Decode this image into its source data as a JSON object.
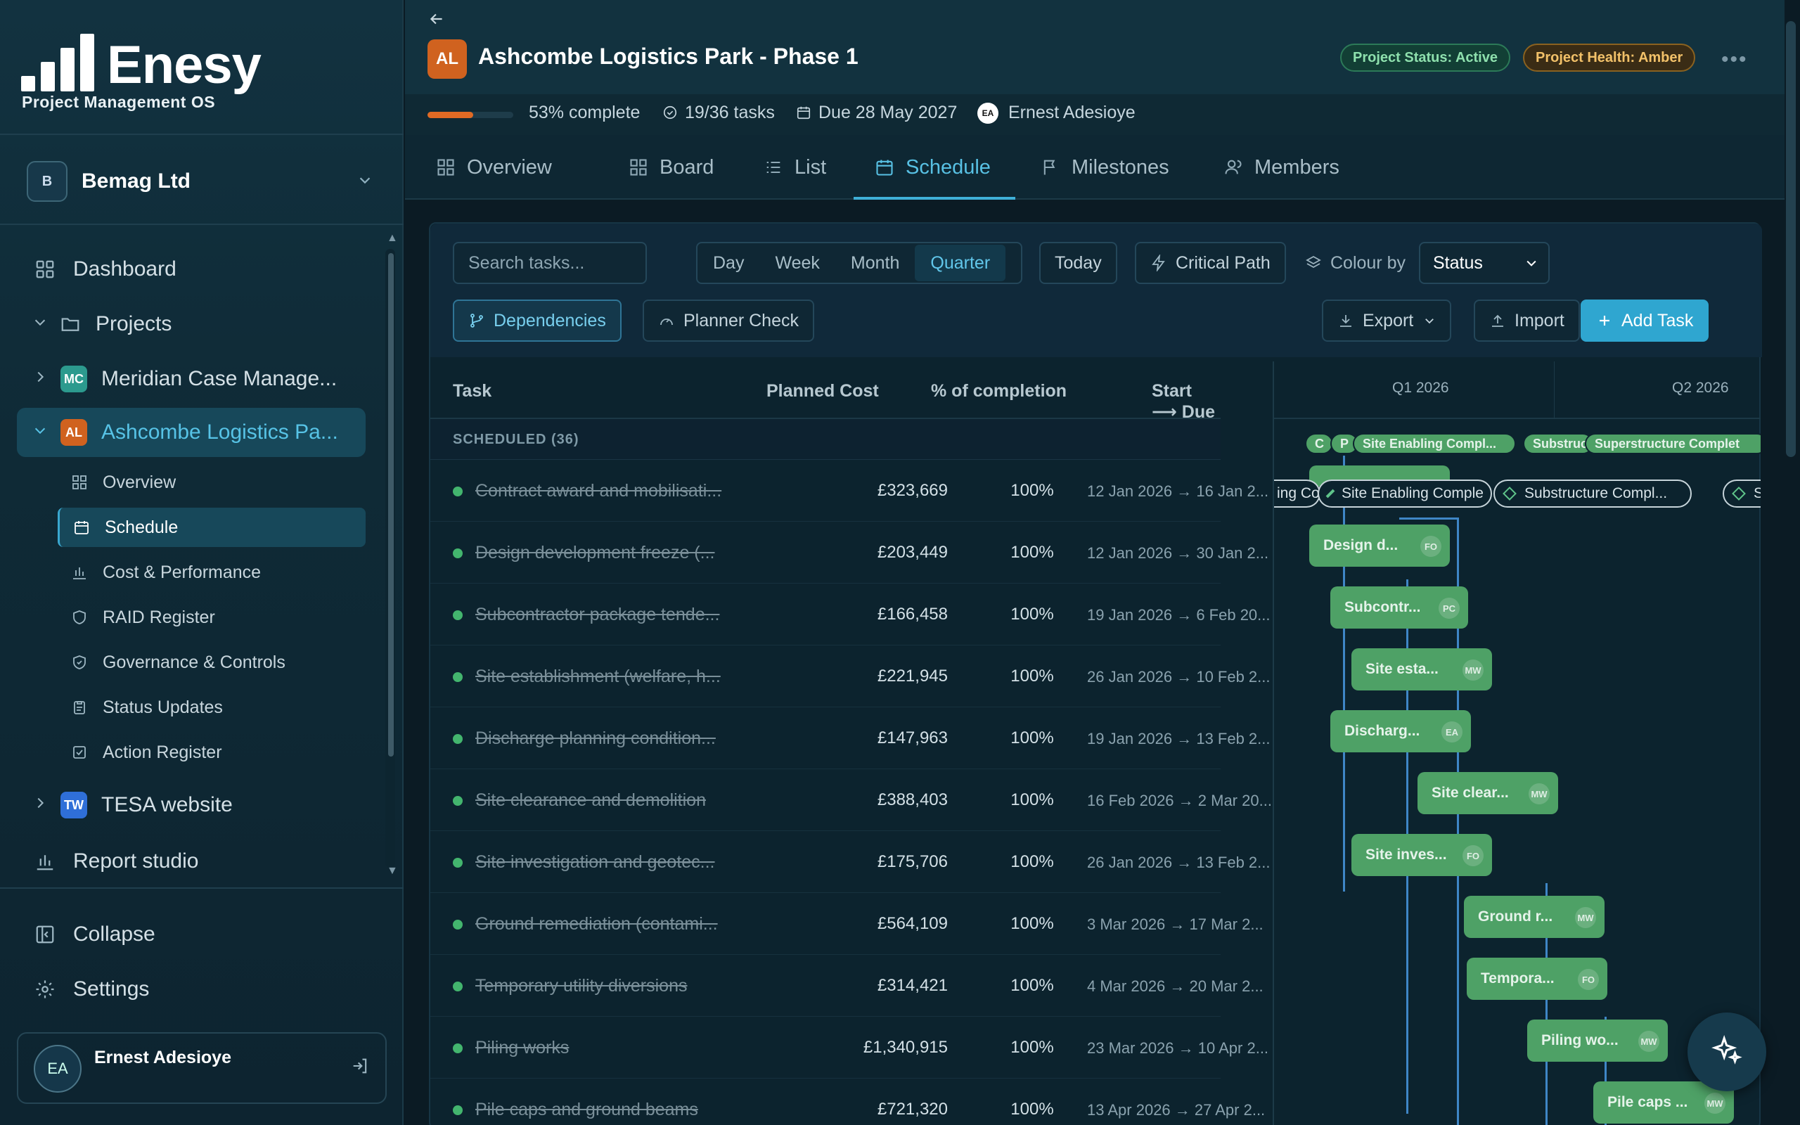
{
  "brand": {
    "name": "Enesy",
    "tagline": "Project Management OS"
  },
  "org": {
    "initial": "B",
    "name": "Bemag Ltd"
  },
  "nav": {
    "dashboard": "Dashboard",
    "projects": "Projects",
    "projects_list": [
      {
        "badge": "MC",
        "label": "Meridian Case Manage...",
        "color": "#2c9a8e"
      },
      {
        "badge": "AL",
        "label": "Ashcombe Logistics Pa...",
        "color": "#d0621f"
      },
      {
        "badge": "TW",
        "label": "TESA website",
        "color": "#2f6fd8"
      }
    ],
    "sub_items": [
      "Overview",
      "Schedule",
      "Cost & Performance",
      "RAID Register",
      "Governance & Controls",
      "Status Updates",
      "Action Register"
    ],
    "report_studio": "Report studio",
    "collapse": "Collapse",
    "settings": "Settings"
  },
  "user": {
    "initials": "EA",
    "name": "Ernest Adesioye"
  },
  "project": {
    "initials": "AL",
    "title": "Ashcombe Logistics Park - Phase 1",
    "status": "Project Status: Active",
    "health": "Project Health: Amber",
    "progress": 53,
    "progress_text": "53% complete",
    "tasks": "19/36 tasks",
    "due": "Due 28 May 2027",
    "owner_initials": "EA",
    "owner": "Ernest Adesioye"
  },
  "tabs": [
    "Overview",
    "Board",
    "List",
    "Schedule",
    "Milestones",
    "Members"
  ],
  "toolbar": {
    "search_placeholder": "Search tasks...",
    "scale": [
      "Day",
      "Week",
      "Month",
      "Quarter"
    ],
    "today": "Today",
    "critical_path": "Critical Path",
    "colour_by": "Colour by",
    "colour_value": "Status",
    "dependencies": "Dependencies",
    "planner_check": "Planner Check",
    "export": "Export",
    "import": "Import",
    "add_task": "Add Task"
  },
  "table": {
    "headers": {
      "task": "Task",
      "cost": "Planned Cost",
      "pct": "% of completion",
      "dates": "Start ⟶ Due"
    },
    "group": "SCHEDULED (36)",
    "rows": [
      {
        "name": "Contract award and mobilisati...",
        "cost": "£323,669",
        "pct": "100%",
        "dates": "12 Jan 2026 → 16 Jan 2..."
      },
      {
        "name": "Design development freeze (...",
        "cost": "£203,449",
        "pct": "100%",
        "dates": "12 Jan 2026 → 30 Jan 2..."
      },
      {
        "name": "Subcontractor package tende...",
        "cost": "£166,458",
        "pct": "100%",
        "dates": "19 Jan 2026 → 6 Feb 20..."
      },
      {
        "name": "Site establishment (welfare, h...",
        "cost": "£221,945",
        "pct": "100%",
        "dates": "26 Jan 2026 → 10 Feb 2..."
      },
      {
        "name": "Discharge planning condition...",
        "cost": "£147,963",
        "pct": "100%",
        "dates": "19 Jan 2026 → 13 Feb 2..."
      },
      {
        "name": "Site clearance and demolition",
        "cost": "£388,403",
        "pct": "100%",
        "dates": "16 Feb 2026 → 2 Mar 20..."
      },
      {
        "name": "Site investigation and geotec...",
        "cost": "£175,706",
        "pct": "100%",
        "dates": "26 Jan 2026 → 13 Feb 2..."
      },
      {
        "name": "Ground remediation (contami...",
        "cost": "£564,109",
        "pct": "100%",
        "dates": "3 Mar 2026 → 17 Mar 2..."
      },
      {
        "name": "Temporary utility diversions",
        "cost": "£314,421",
        "pct": "100%",
        "dates": "4 Mar 2026 → 20 Mar 2..."
      },
      {
        "name": "Piling works",
        "cost": "£1,340,915",
        "pct": "100%",
        "dates": "23 Mar 2026 → 10 Apr 2..."
      },
      {
        "name": "Pile caps and ground beams",
        "cost": "£721,320",
        "pct": "100%",
        "dates": "13 Apr 2026 → 27 Apr 2..."
      }
    ]
  },
  "gantt": {
    "quarters": [
      "Q1 2026",
      "Q2 2026"
    ],
    "summary_pills": [
      "C",
      "P",
      "Site Enabling Compl...",
      "Substruc",
      "Superstructure Complet"
    ],
    "milestones": [
      "ing Co",
      "Site Enabling Comple",
      "Substructure Compl...",
      "S"
    ],
    "bars": [
      {
        "label": "",
        "ini": ""
      },
      {
        "label": "Design d...",
        "ini": "FO"
      },
      {
        "label": "Subcontr...",
        "ini": "PC"
      },
      {
        "label": "Site esta...",
        "ini": "MW"
      },
      {
        "label": "Discharg...",
        "ini": "EA"
      },
      {
        "label": "Site clear...",
        "ini": "MW"
      },
      {
        "label": "Site inves...",
        "ini": "FO"
      },
      {
        "label": "Ground r...",
        "ini": "MW"
      },
      {
        "label": "Tempora...",
        "ini": "FO"
      },
      {
        "label": "Piling wo...",
        "ini": "MW"
      },
      {
        "label": "Pile caps ...",
        "ini": "MW"
      }
    ]
  }
}
